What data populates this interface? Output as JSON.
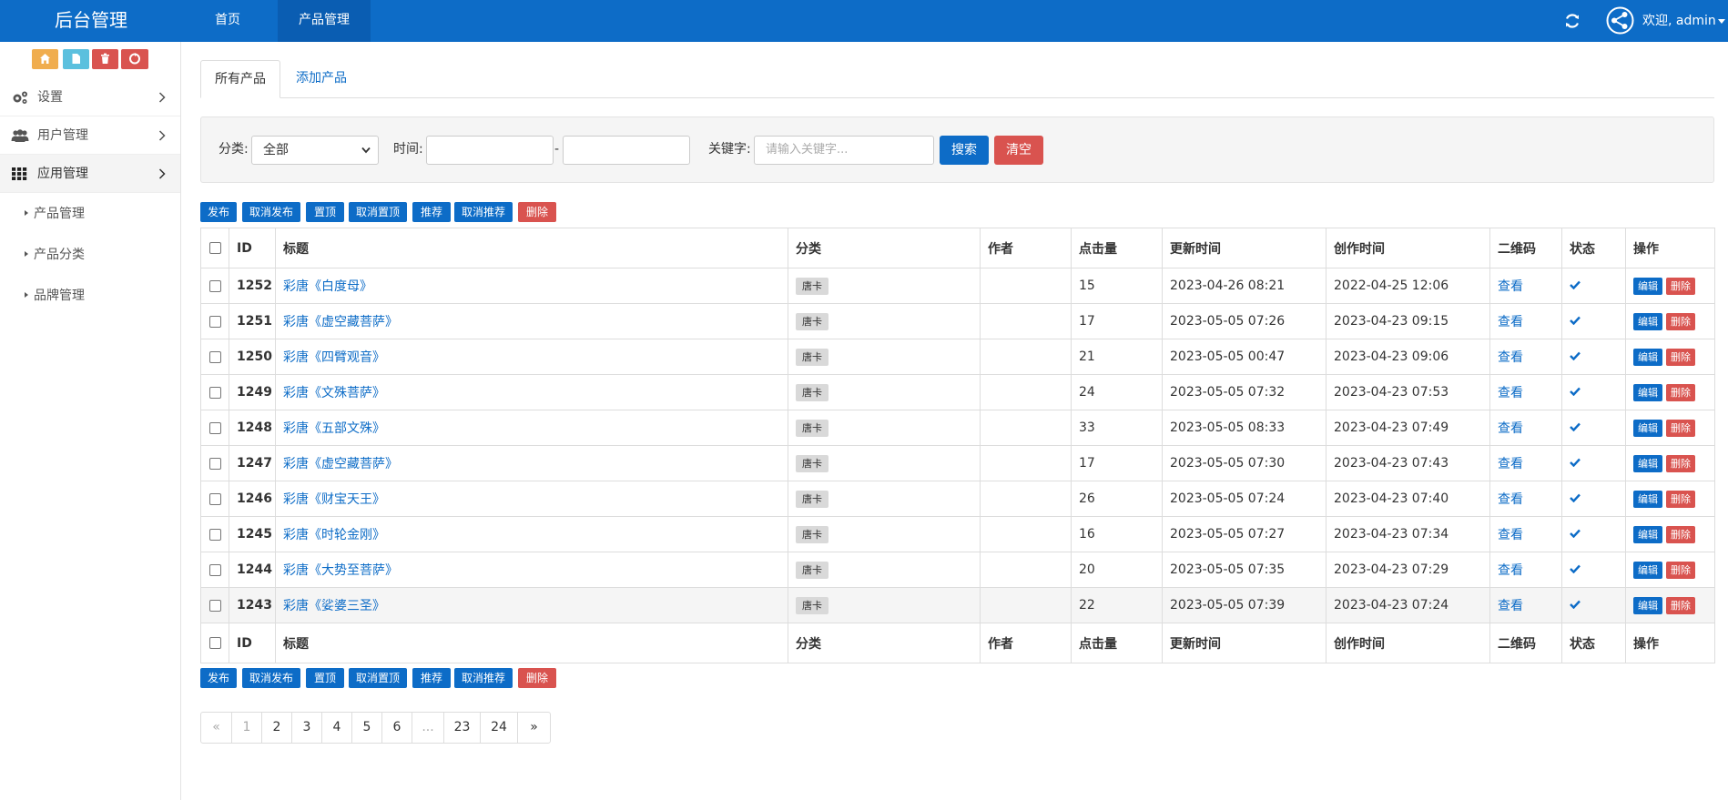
{
  "header": {
    "brand": "后台管理",
    "nav": [
      "首页",
      "产品管理"
    ],
    "welcome": "欢迎, admin"
  },
  "sidebar": {
    "menu": [
      "设置",
      "用户管理",
      "应用管理"
    ],
    "submenu": [
      "产品管理",
      "产品分类",
      "品牌管理"
    ]
  },
  "tabs": [
    "所有产品",
    "添加产品"
  ],
  "filter": {
    "category_label": "分类:",
    "category_value": "全部",
    "time_label": "时间:",
    "time_sep": "-",
    "keyword_label": "关键字:",
    "keyword_placeholder": "请输入关键字...",
    "search": "搜索",
    "clear": "清空"
  },
  "actions": [
    "发布",
    "取消发布",
    "置顶",
    "取消置顶",
    "推荐",
    "取消推荐",
    "删除"
  ],
  "table": {
    "headers": [
      "ID",
      "标题",
      "分类",
      "作者",
      "点击量",
      "更新时间",
      "创作时间",
      "二维码",
      "状态",
      "操作"
    ],
    "rows": [
      {
        "id": "1252",
        "title": "彩唐《白度母》",
        "category": "唐卡",
        "author": "",
        "clicks": "15",
        "updated": "2023-04-26 08:21",
        "created": "2022-04-25 12:06"
      },
      {
        "id": "1251",
        "title": "彩唐《虚空藏菩萨》",
        "category": "唐卡",
        "author": "",
        "clicks": "17",
        "updated": "2023-05-05 07:26",
        "created": "2023-04-23 09:15"
      },
      {
        "id": "1250",
        "title": "彩唐《四臂观音》",
        "category": "唐卡",
        "author": "",
        "clicks": "21",
        "updated": "2023-05-05 00:47",
        "created": "2023-04-23 09:06"
      },
      {
        "id": "1249",
        "title": "彩唐《文殊菩萨》",
        "category": "唐卡",
        "author": "",
        "clicks": "24",
        "updated": "2023-05-05 07:32",
        "created": "2023-04-23 07:53"
      },
      {
        "id": "1248",
        "title": "彩唐《五部文殊》",
        "category": "唐卡",
        "author": "",
        "clicks": "33",
        "updated": "2023-05-05 08:33",
        "created": "2023-04-23 07:49"
      },
      {
        "id": "1247",
        "title": "彩唐《虚空藏菩萨》",
        "category": "唐卡",
        "author": "",
        "clicks": "17",
        "updated": "2023-05-05 07:30",
        "created": "2023-04-23 07:43"
      },
      {
        "id": "1246",
        "title": "彩唐《财宝天王》",
        "category": "唐卡",
        "author": "",
        "clicks": "26",
        "updated": "2023-05-05 07:24",
        "created": "2023-04-23 07:40"
      },
      {
        "id": "1245",
        "title": "彩唐《时轮金刚》",
        "category": "唐卡",
        "author": "",
        "clicks": "16",
        "updated": "2023-05-05 07:27",
        "created": "2023-04-23 07:34"
      },
      {
        "id": "1244",
        "title": "彩唐《大势至菩萨》",
        "category": "唐卡",
        "author": "",
        "clicks": "20",
        "updated": "2023-05-05 07:35",
        "created": "2023-04-23 07:29"
      },
      {
        "id": "1243",
        "title": "彩唐《娑婆三圣》",
        "category": "唐卡",
        "author": "",
        "clicks": "22",
        "updated": "2023-05-05 07:39",
        "created": "2023-04-23 07:24"
      }
    ],
    "qr_link": "查看",
    "edit": "编辑",
    "delete": "删除"
  },
  "pagination": [
    "«",
    "1",
    "2",
    "3",
    "4",
    "5",
    "6",
    "...",
    "23",
    "24",
    "»"
  ]
}
